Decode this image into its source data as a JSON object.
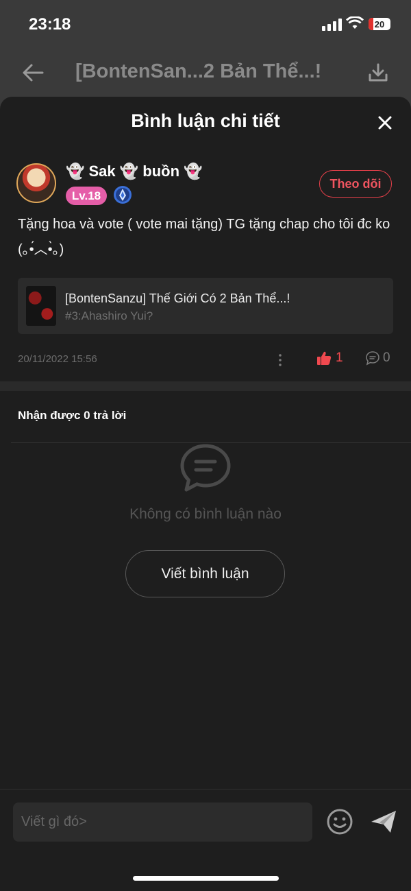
{
  "status_bar": {
    "time": "23:18",
    "battery": "20"
  },
  "background_nav": {
    "title": "[BontenSan...2 Bản Thể...!"
  },
  "sheet": {
    "title": "Bình luận chi tiết",
    "comment": {
      "username": "👻 Sak 👻 buồn 👻",
      "level": "Lv.18",
      "follow_label": "Theo dõi",
      "text": "Tặng hoa và vote ( vote mai tặng) TG tặng chap cho tôi đc ko (｡•́︿•̀｡)",
      "chapter": {
        "title": "[BontenSanzu] Thế Giới Có 2 Bản Thể...!",
        "subtitle": "#3:Ahashiro Yui?"
      },
      "timestamp": "20/11/2022 15:56",
      "likes": "1",
      "replies": "0"
    },
    "replies_label": "Nhận được 0 trả lời",
    "empty_text": "Không có bình luận nào",
    "write_button": "Viết bình luận"
  },
  "composer": {
    "placeholder": "Viết gì đó>"
  },
  "colors": {
    "accent": "#f0494f",
    "level_badge": "#e55ea8"
  }
}
